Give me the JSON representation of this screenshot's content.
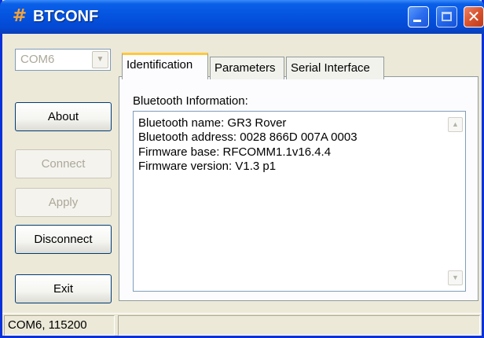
{
  "window": {
    "title": "BTCONF",
    "icon": "bluetooth-hash-icon",
    "icon_glyph": "#",
    "close_glyph": "✕"
  },
  "sidebar": {
    "com_port": {
      "value": "COM6",
      "arrow_glyph": "▼"
    },
    "buttons": {
      "about": "About",
      "connect": "Connect",
      "apply": "Apply",
      "disconnect": "Disconnect",
      "exit": "Exit"
    }
  },
  "tabs": [
    {
      "label": "Identification",
      "active": true
    },
    {
      "label": "Parameters",
      "active": false
    },
    {
      "label": "Serial Interface",
      "active": false
    }
  ],
  "identification": {
    "group_label": "Bluetooth Information:",
    "lines": [
      "Bluetooth name: GR3 Rover",
      "Bluetooth address: 0028 866D 007A 0003",
      "Firmware base: RFCOMM1.1v16.4.4",
      "Firmware version: V1.3 p1"
    ],
    "scroll_up_glyph": "▲",
    "scroll_down_glyph": "▼"
  },
  "statusbar": {
    "connection": "COM6, 115200",
    "message": ""
  },
  "colors": {
    "titlebar": "#0454e0",
    "window_bg": "#ece9d8",
    "disabled_text": "#aca899",
    "active_tab_accent": "#ffc83c"
  }
}
